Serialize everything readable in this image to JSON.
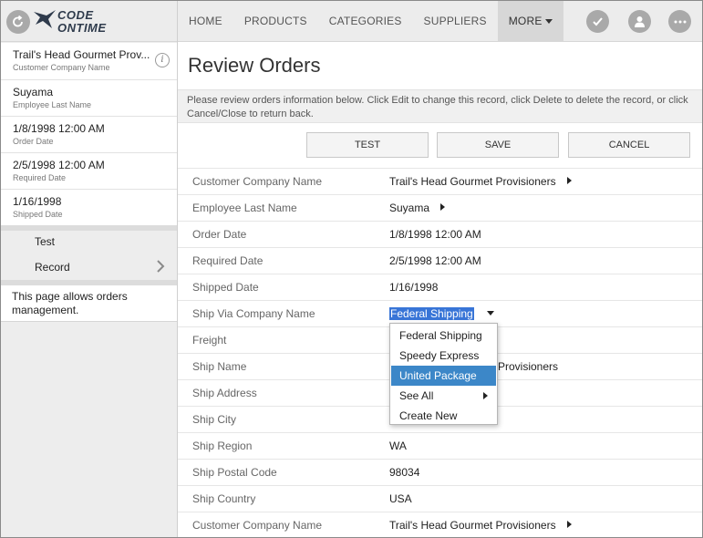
{
  "app": {
    "logo": {
      "line1": "CODE",
      "line2": "ONTIME"
    }
  },
  "topbar": {
    "menu": [
      {
        "label": "HOME",
        "active": false
      },
      {
        "label": "PRODUCTS",
        "active": false
      },
      {
        "label": "CATEGORIES",
        "active": false
      },
      {
        "label": "SUPPLIERS",
        "active": false
      },
      {
        "label": "MORE",
        "active": true
      }
    ],
    "icons": [
      "checkmark-icon",
      "user-icon",
      "more-options-icon"
    ]
  },
  "sidebar": {
    "summary": [
      {
        "value": "Trail's Head Gourmet Prov...",
        "label": "Customer Company Name"
      },
      {
        "value": "Suyama",
        "label": "Employee Last Name"
      },
      {
        "value": "1/8/1998 12:00 AM",
        "label": "Order Date"
      },
      {
        "value": "2/5/1998 12:00 AM",
        "label": "Required Date"
      },
      {
        "value": "1/16/1998",
        "label": "Shipped Date"
      }
    ],
    "nav": [
      {
        "label": "Test"
      },
      {
        "label": "Record"
      }
    ],
    "description": "This page allows orders management."
  },
  "main": {
    "title": "Review Orders",
    "description": "Please review orders information below. Click Edit to change this record, click Delete to delete the record, or click Cancel/Close to return back.",
    "buttons": {
      "test": "TEST",
      "save": "SAVE",
      "cancel": "CANCEL"
    },
    "fields": [
      {
        "label": "Customer Company Name",
        "value": "Trail's Head Gourmet Provisioners"
      },
      {
        "label": "Employee Last Name",
        "value": "Suyama"
      },
      {
        "label": "Order Date",
        "value": "1/8/1998 12:00 AM"
      },
      {
        "label": "Required Date",
        "value": "2/5/1998 12:00 AM"
      },
      {
        "label": "Shipped Date",
        "value": "1/16/1998"
      },
      {
        "label": "Ship Via Company Name",
        "value": "Federal Shipping"
      },
      {
        "label": "Freight",
        "value": ""
      },
      {
        "label": "Ship Name",
        "value": "Provisioners"
      },
      {
        "label": "Ship Address",
        "value": ""
      },
      {
        "label": "Ship City",
        "value": ""
      },
      {
        "label": "Ship Region",
        "value": "WA"
      },
      {
        "label": "Ship Postal Code",
        "value": "98034"
      },
      {
        "label": "Ship Country",
        "value": "USA"
      },
      {
        "label": "Customer Company Name",
        "value": "Trail's Head Gourmet Provisioners"
      }
    ],
    "dropdown": {
      "items": [
        {
          "label": "Federal Shipping",
          "highlighted": false
        },
        {
          "label": "Speedy Express",
          "highlighted": false
        },
        {
          "label": "United Package",
          "highlighted": true
        },
        {
          "label": "See All",
          "highlighted": false,
          "submenu": true
        },
        {
          "label": "Create New",
          "highlighted": false
        }
      ]
    }
  },
  "colors": {
    "selection": "#3875d7",
    "highlight": "#3c87c8",
    "sidebar_bg": "#ededed",
    "topbar_bg": "#ececec"
  }
}
